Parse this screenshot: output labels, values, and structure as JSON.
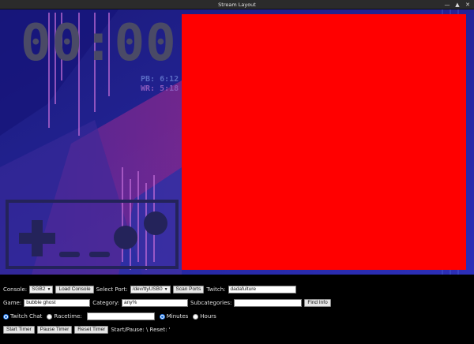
{
  "window": {
    "title": "Stream Layout"
  },
  "overlay": {
    "timer": "00:00",
    "pb": "PB: 6:12",
    "wr": "WR: 5:18"
  },
  "controls": {
    "console_label": "Console:",
    "console_value": "SGB2",
    "load_console": "Load Console",
    "port_label": "Select Port:",
    "port_value": "/dev/ttyUSB0",
    "scan_ports": "Scan Ports",
    "twitch_label": "Twitch:",
    "twitch_value": "dadafulture",
    "game_label": "Game:",
    "game_value": "bubble ghost",
    "category_label": "Category:",
    "category_value": "any%",
    "subcat_label": "Subcategories:",
    "subcat_value": "",
    "find_info": "Find Info",
    "twitch_chat": "Twitch Chat",
    "racetime_label": "Racetime:",
    "racetime_value": "",
    "minutes": "Minutes",
    "hours": "Hours",
    "start_timer": "Start Timer",
    "pause_timer": "Pause Timer",
    "reset_timer": "Reset Timer",
    "status": "Start/Pause: \\   Reset: '"
  },
  "colors": {
    "camera": "#ff0000",
    "timer": "#4a4a66",
    "pb": "#5a6bc4",
    "wr": "#8a5abd"
  }
}
